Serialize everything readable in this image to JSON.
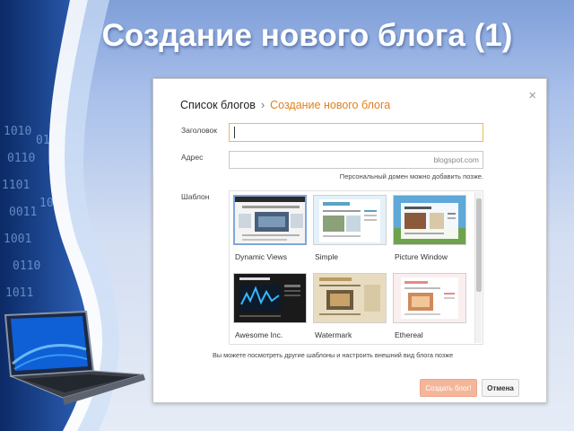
{
  "slide": {
    "title": "Создание нового блога (1)"
  },
  "dialog": {
    "breadcrumb": {
      "parent": "Список блогов",
      "separator": "›",
      "current": "Создание нового блога"
    },
    "close_label": "×",
    "fields": {
      "title_label": "Заголовок",
      "title_value": "",
      "address_label": "Адрес",
      "address_suffix": "blogspot.com",
      "address_hint": "Персональный домен можно добавить позже.",
      "template_label": "Шаблон"
    },
    "templates": [
      {
        "name": "Dynamic Views",
        "selected": true
      },
      {
        "name": "Simple",
        "selected": false
      },
      {
        "name": "Picture Window",
        "selected": false
      },
      {
        "name": "Awesome Inc.",
        "selected": false
      },
      {
        "name": "Watermark",
        "selected": false
      },
      {
        "name": "Ethereal",
        "selected": false
      }
    ],
    "footer_note": "Вы можете посмотреть другие шаблоны и настроить внешний вид блога позже",
    "buttons": {
      "create": "Создать блог!",
      "cancel": "Отмена"
    }
  },
  "colors": {
    "breadcrumb_accent": "#e0801e",
    "title_input_border": "#e8bc52",
    "selected_template_border": "#7fa7d8",
    "create_button": "#f4b69a"
  }
}
